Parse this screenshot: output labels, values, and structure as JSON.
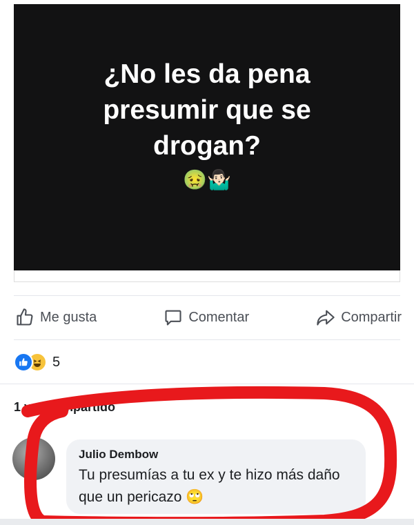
{
  "post": {
    "image_text": "¿No les da pena presumir que se drogan?",
    "image_emojis": "🤢🤷🏻‍♂️"
  },
  "actions": {
    "like_label": "Me gusta",
    "comment_label": "Comentar",
    "share_label": "Compartir"
  },
  "reactions": {
    "types": [
      "like",
      "haha"
    ],
    "count": "5"
  },
  "shares": {
    "label": "1 vez compartido"
  },
  "comment": {
    "author": "Julio Dembow",
    "text": "Tu presumías a tu ex y te hizo más daño que un pericazo 🙄"
  },
  "colors": {
    "image_background": "#121213",
    "like_blue": "#1877f2",
    "haha_yellow": "#f7c33b",
    "annotation_red": "#e8191c",
    "comment_bubble": "#f0f2f5"
  }
}
